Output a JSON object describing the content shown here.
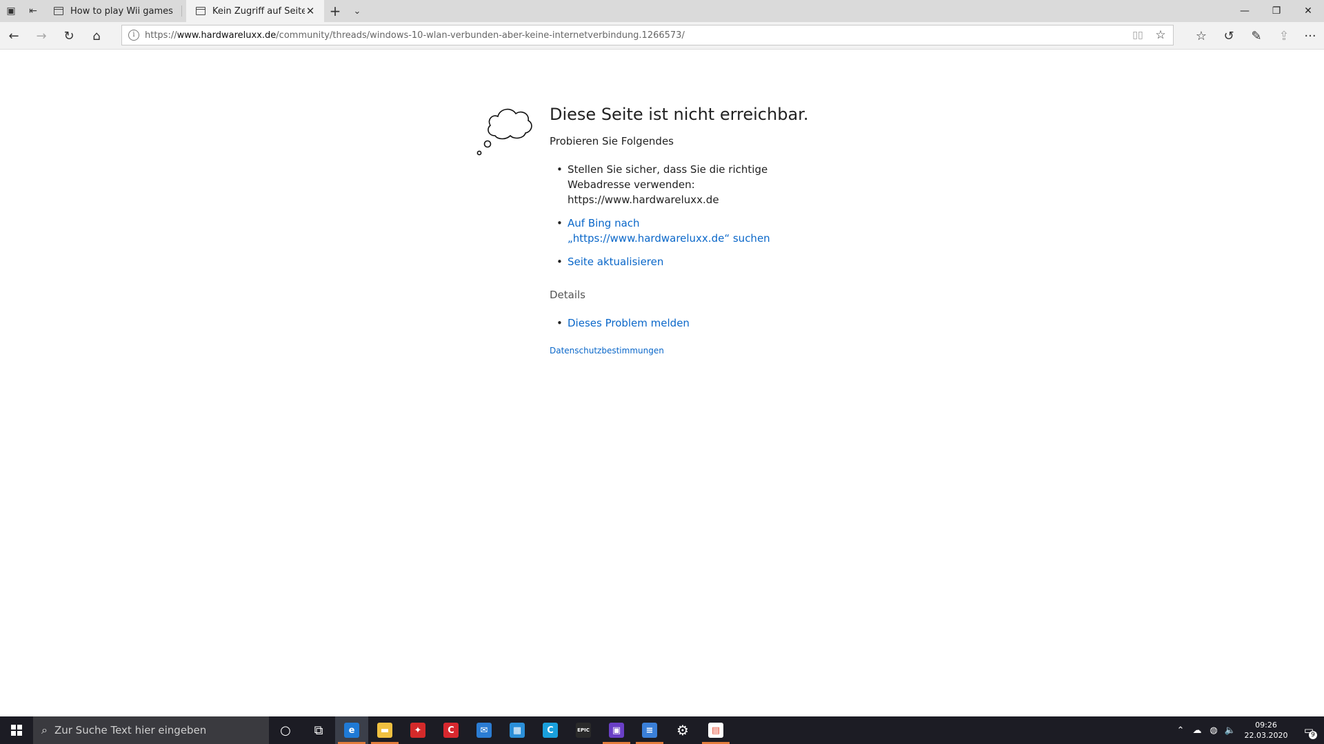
{
  "tabs": [
    {
      "title": "How to play Wii games onli",
      "active": false
    },
    {
      "title": "Kein Zugriff auf Seite",
      "active": true
    }
  ],
  "address": {
    "scheme": "https://",
    "host": "www.hardwareluxx.de",
    "path": "/community/threads/windows-10-wlan-verbunden-aber-keine-internetverbindung.1266573/"
  },
  "error": {
    "heading": "Diese Seite ist nicht erreichbar.",
    "subheading": "Probieren Sie Folgendes",
    "suggestion_1_line1": "Stellen Sie sicher, dass Sie die richtige",
    "suggestion_1_line2": "Webadresse verwenden:",
    "suggestion_1_url": "https://www.hardwareluxx.de",
    "bing_line1": "Auf Bing nach",
    "bing_line2": "„https://www.hardwareluxx.de“ suchen",
    "refresh": "Seite aktualisieren",
    "details_title": "Details",
    "report": "Dieses Problem melden",
    "privacy": "Datenschutzbestimmungen"
  },
  "taskbar": {
    "search_placeholder": "Zur Suche Text hier eingeben",
    "time": "09:26",
    "date": "22.03.2020",
    "notification_count": "9",
    "apps": [
      {
        "name": "edge-app-icon",
        "color": "#1f7ad6",
        "glyph": "e"
      },
      {
        "name": "file-explorer-icon",
        "color": "#f0c040",
        "glyph": "▬"
      },
      {
        "name": "app-red-icon",
        "color": "#d42a2a",
        "glyph": "✦"
      },
      {
        "name": "ccleaner-icon",
        "color": "#d8282f",
        "glyph": "C"
      },
      {
        "name": "outlook-app-icon",
        "color": "#2b7cd3",
        "glyph": "✉"
      },
      {
        "name": "app-building-icon",
        "color": "#2b8fd8",
        "glyph": "▦"
      },
      {
        "name": "app-c-icon",
        "color": "#1aa0dc",
        "glyph": "C"
      },
      {
        "name": "epic-games-icon",
        "color": "#2a2a2a",
        "glyph": "EPIC"
      },
      {
        "name": "twitch-icon",
        "color": "#6a3fc6",
        "glyph": "▣"
      },
      {
        "name": "notepad-app-icon",
        "color": "#3a7fd8",
        "glyph": "≡"
      },
      {
        "name": "settings-icon",
        "color": "transparent",
        "glyph": "⚙"
      },
      {
        "name": "store-icon",
        "color": "#ffffff",
        "glyph": "▤"
      }
    ]
  }
}
